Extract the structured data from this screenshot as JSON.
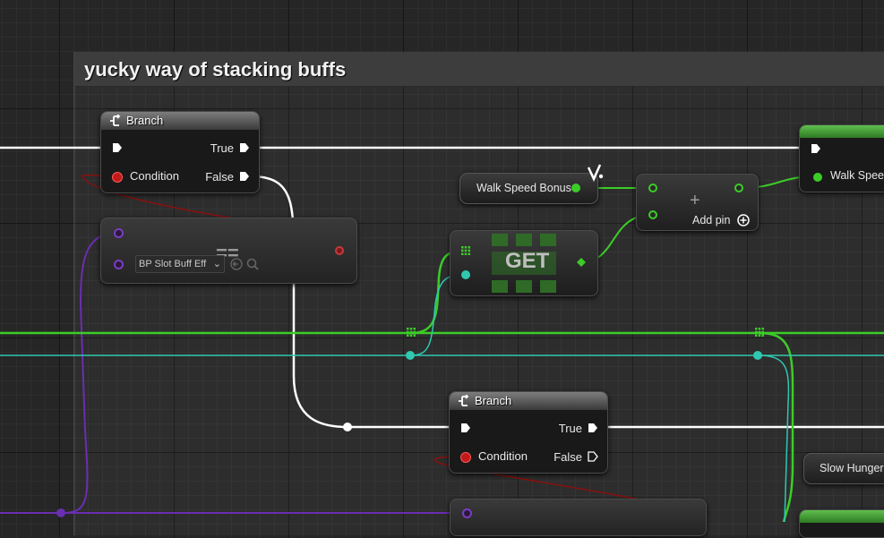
{
  "comment": {
    "title": "yucky way of stacking buffs"
  },
  "branch_top": {
    "title": "Branch",
    "true_label": "True",
    "false_label": "False",
    "condition_label": "Condition"
  },
  "equal_node": {
    "symbol": "==",
    "dropdown_value": "BP Slot Buff Eff"
  },
  "get_node": {
    "label": "GET"
  },
  "walk_speed_bonus": {
    "label": "Walk Speed Bonus"
  },
  "add_node": {
    "symbol": "+",
    "add_pin_label": "Add pin"
  },
  "set_node_partial": {
    "label": "Walk Speed"
  },
  "branch_bottom": {
    "title": "Branch",
    "true_label": "True",
    "false_label": "False",
    "condition_label": "Condition"
  },
  "slow_hunger": {
    "label": "Slow Hunger"
  },
  "colors": {
    "exec": "#ffffff",
    "float": "#3ccc28",
    "bool": "#a00000",
    "object": "#7c3cc4",
    "teal": "#2ec9b0",
    "set_header": "#3d9a2b"
  },
  "icons": {
    "branch": "branch-icon",
    "variable": "variable-icon",
    "add_pin": "add-circle-icon",
    "use_selected": "arrow-left-icon",
    "browse": "magnifier-icon"
  }
}
